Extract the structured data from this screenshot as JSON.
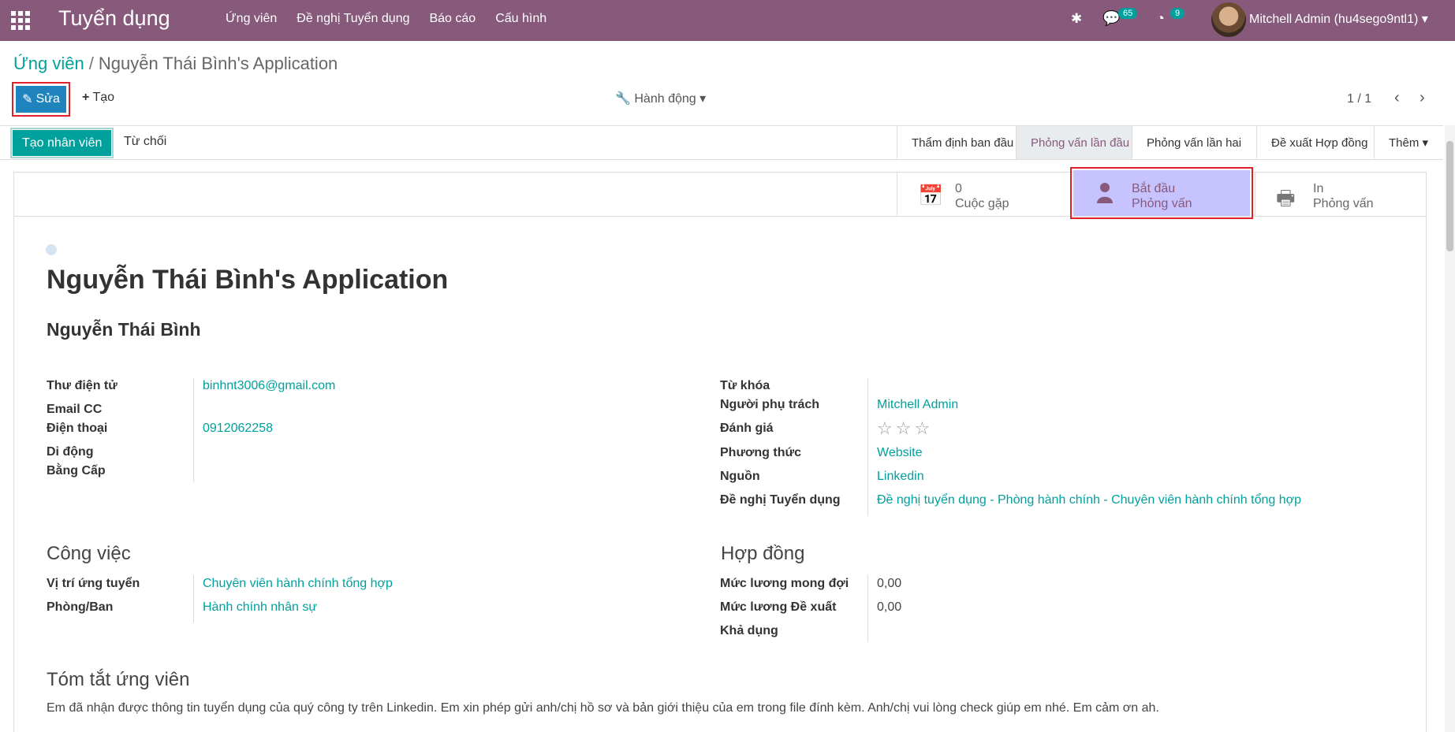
{
  "navbar": {
    "app_title": "Tuyển dụng",
    "menu": [
      "Ứng viên",
      "Đề nghị Tuyển dụng",
      "Báo cáo",
      "Cấu hình"
    ],
    "messages_count": "65",
    "activities_count": "9",
    "user_name": "Mitchell Admin (hu4sego9ntl1)"
  },
  "breadcrumb": {
    "parent": "Ứng viên",
    "sep": "/",
    "current": "Nguyễn Thái Bình's Application"
  },
  "controls": {
    "edit": "Sửa",
    "create": "Tạo",
    "action": "Hành động",
    "pager": "1 / 1"
  },
  "statusbar": {
    "create_employee": "Tạo nhân viên",
    "refuse": "Từ chối",
    "stages": [
      "Thẩm định ban đầu",
      "Phỏng vấn lần đầu",
      "Phỏng vấn lần hai",
      "Đề xuất Hợp đồng",
      "Thêm"
    ]
  },
  "smart_buttons": {
    "meetings_count": "0",
    "meetings_label": "Cuộc gặp",
    "start_l1": "Bắt đầu",
    "start_l2": "Phỏng vấn",
    "print_l1": "In",
    "print_l2": "Phỏng vấn"
  },
  "form": {
    "title": "Nguyễn Thái Bình's Application",
    "partner_name": "Nguyễn Thái Bình",
    "left": {
      "email_label": "Thư điện tử",
      "email": "binhnt3006@gmail.com",
      "cc_label": "Email CC",
      "phone_label": "Điện thoại",
      "phone": "0912062258",
      "mobile_label": "Di động",
      "degree_label": "Bằng Cấp"
    },
    "right": {
      "tags_label": "Từ khóa",
      "responsible_label": "Người phụ trách",
      "responsible": "Mitchell Admin",
      "rating_label": "Đánh giá",
      "rating_stars": 0,
      "medium_label": "Phương thức",
      "medium": "Website",
      "source_label": "Nguồn",
      "source": "Linkedin",
      "job_req_label": "Đề nghị Tuyển dụng",
      "job_req": "Đề nghị tuyển dụng - Phòng hành chính - Chuyên viên hành chính tổng hợp"
    },
    "job": {
      "section": "Công việc",
      "position_label": "Vị trí ứng tuyển",
      "position": "Chuyên viên hành chính tổng hợp",
      "dept_label": "Phòng/Ban",
      "dept": "Hành chính nhân sự"
    },
    "contract": {
      "section": "Hợp đồng",
      "expected_label": "Mức lương mong đợi",
      "expected": "0,00",
      "proposed_label": "Mức lương Đề xuất",
      "proposed": "0,00",
      "availability_label": "Khả dụng"
    },
    "summary": {
      "section": "Tóm tắt ứng viên",
      "text": "Em đã nhận được thông tin tuyển dụng của quý công ty trên Linkedin. Em xin phép gửi anh/chị hồ sơ và bản giới thiệu của em trong file đính kèm. Anh/chị vui lòng check giúp em nhé. Em cảm ơn ah."
    }
  },
  "colors": {
    "brand": "#875a7b",
    "accent": "#00a09d",
    "primary": "#1f84be",
    "highlight": "#c6c3ff"
  }
}
